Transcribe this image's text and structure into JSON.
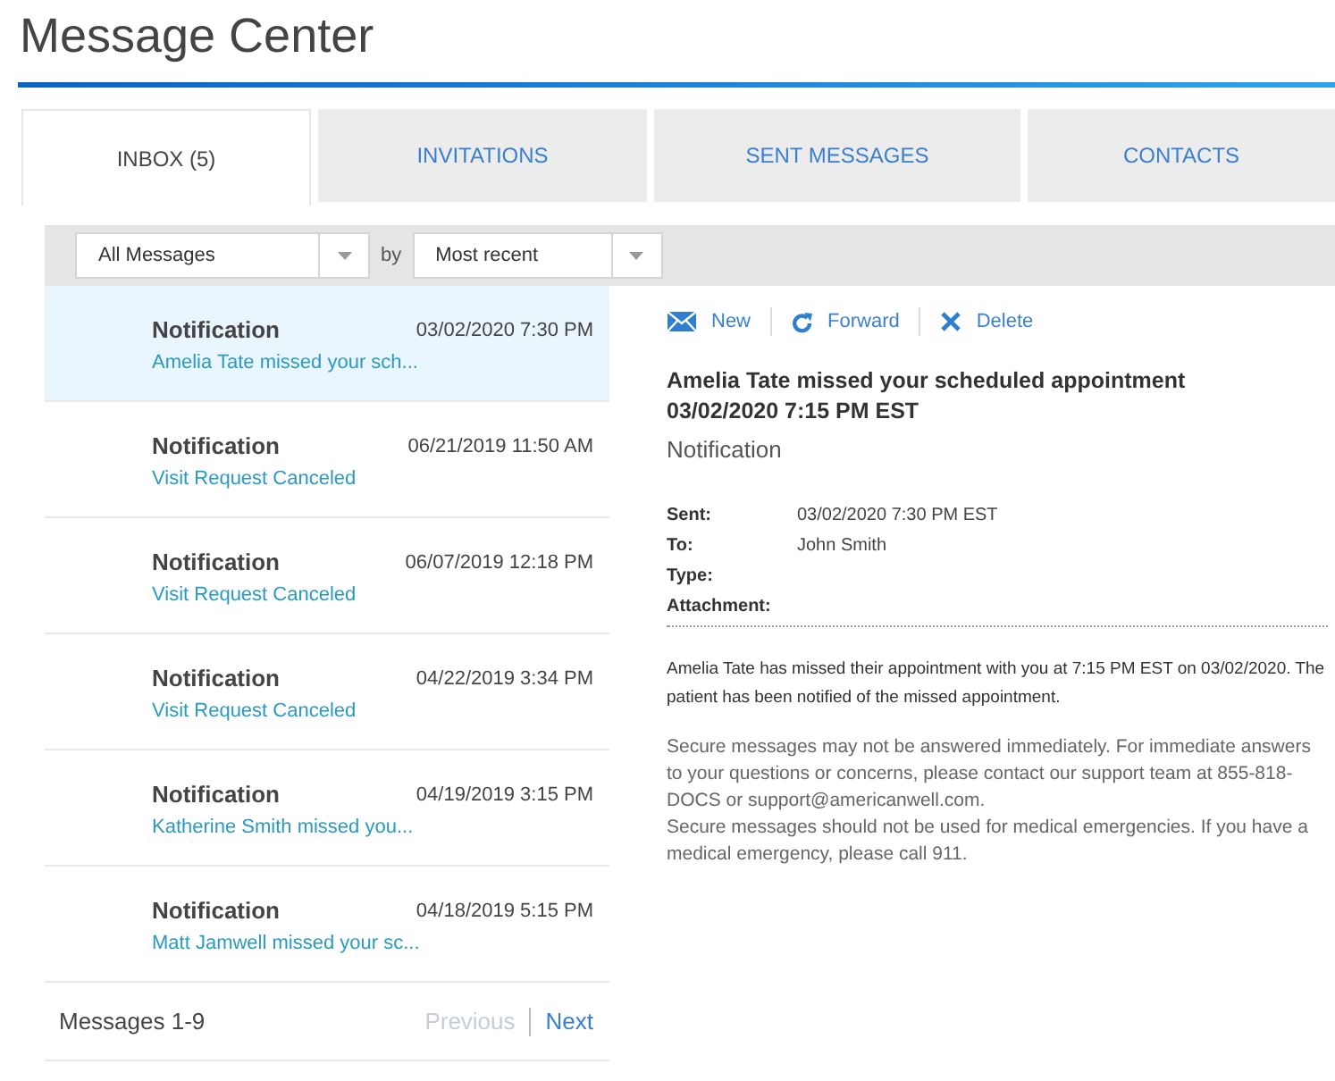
{
  "page_title": "Message Center",
  "tabs": [
    {
      "label": "INBOX (5)",
      "selected": true
    },
    {
      "label": "INVITATIONS",
      "selected": false
    },
    {
      "label": "SENT MESSAGES",
      "selected": false
    },
    {
      "label": "CONTACTS",
      "selected": false
    }
  ],
  "filter": {
    "type_value": "All Messages",
    "by_label": "by",
    "sort_value": "Most recent"
  },
  "messages": [
    {
      "title": "Notification",
      "date": "03/02/2020 7:30 PM",
      "preview": "Amelia Tate missed your sch...",
      "selected": true
    },
    {
      "title": "Notification",
      "date": "06/21/2019 11:50 AM",
      "preview": "Visit Request Canceled",
      "selected": false
    },
    {
      "title": "Notification",
      "date": "06/07/2019 12:18 PM",
      "preview": "Visit Request Canceled",
      "selected": false
    },
    {
      "title": "Notification",
      "date": "04/22/2019 3:34 PM",
      "preview": "Visit Request Canceled",
      "selected": false
    },
    {
      "title": "Notification",
      "date": "04/19/2019 3:15 PM",
      "preview": "Katherine Smith missed you...",
      "selected": false
    },
    {
      "title": "Notification",
      "date": "04/18/2019 5:15 PM",
      "preview": "Matt Jamwell missed your sc...",
      "selected": false
    }
  ],
  "pager": {
    "count": "Messages 1-9",
    "buttons": [
      {
        "label": "Previous",
        "disabled": true
      },
      {
        "label": "Next",
        "disabled": false
      }
    ]
  },
  "actions": [
    {
      "kind": "new",
      "label": "New"
    },
    {
      "kind": "forward",
      "label": "Forward"
    },
    {
      "kind": "delete",
      "label": "Delete"
    }
  ],
  "detail": {
    "subject": "Amelia Tate missed your scheduled appointment",
    "subject_date": "03/02/2020 7:15 PM EST",
    "category": "Notification",
    "fields": [
      {
        "label": "Sent:",
        "value": "03/02/2020 7:30 PM EST"
      },
      {
        "label": "To:",
        "value": "John Smith"
      },
      {
        "label": "Type:"
      },
      {
        "label": "Attachment:"
      }
    ],
    "body": "Amelia Tate has missed their appointment with you at 7:15 PM EST on 03/02/2020. The patient has been notified of the missed appointment.",
    "notice": [
      "Secure messages may not be answered immediately. For immediate answers to your questions or concerns, please contact our support team at 855-818-DOCS or support@americanwell.com.",
      "Secure messages should not be used for medical emergencies. If you have a medical emergency, please call 911."
    ]
  }
}
